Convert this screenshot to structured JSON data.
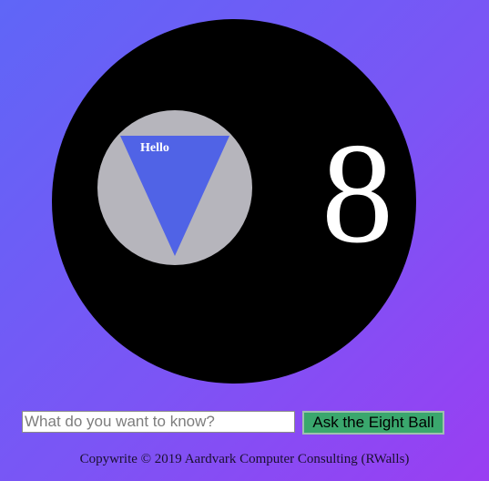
{
  "eight_ball": {
    "number": "8",
    "answer": "Hello",
    "colors": {
      "ball": "#000000",
      "window": "#b6b5bc",
      "triangle": "#5063e6",
      "text": "#ffffff"
    }
  },
  "form": {
    "question_value": "",
    "question_placeholder": "What do you want to know?",
    "ask_button_label": "Ask the Eight Ball",
    "ask_button_color": "#3aa76d"
  },
  "footer": {
    "text": "Copywrite © 2019 Aardvark Computer Consulting (RWalls)"
  },
  "colors": {
    "background_start": "#5f66f7",
    "background_end": "#9a3ef2"
  }
}
